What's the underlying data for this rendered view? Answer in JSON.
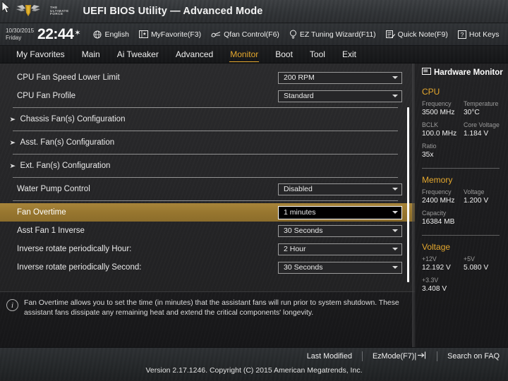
{
  "header": {
    "title": "UEFI BIOS Utility — Advanced Mode",
    "logo": {
      "line1": "THE",
      "line2": "ULTIMATE",
      "line3": "FORCE"
    }
  },
  "toolbar": {
    "date": "10/30/2015",
    "weekday": "Friday",
    "time": "22:44",
    "items": [
      {
        "label": "English",
        "icon": "globe-icon"
      },
      {
        "label": "MyFavorite(F3)",
        "icon": "star-book-icon"
      },
      {
        "label": "Qfan Control(F6)",
        "icon": "fan-icon"
      },
      {
        "label": "EZ Tuning Wizard(F11)",
        "icon": "lightbulb-icon"
      },
      {
        "label": "Quick Note(F9)",
        "icon": "note-icon"
      },
      {
        "label": "Hot Keys",
        "icon": "question-key-icon"
      }
    ]
  },
  "nav": {
    "tabs": [
      {
        "label": "My Favorites",
        "active": false
      },
      {
        "label": "Main",
        "active": false
      },
      {
        "label": "Ai Tweaker",
        "active": false
      },
      {
        "label": "Advanced",
        "active": false
      },
      {
        "label": "Monitor",
        "active": true
      },
      {
        "label": "Boot",
        "active": false
      },
      {
        "label": "Tool",
        "active": false
      },
      {
        "label": "Exit",
        "active": false
      }
    ],
    "active_color": "#e5a82e"
  },
  "settings": {
    "rows": [
      {
        "type": "setting",
        "label": "CPU Fan Speed Lower Limit",
        "value": "200 RPM",
        "selected": false
      },
      {
        "type": "setting",
        "label": "CPU Fan Profile",
        "value": "Standard",
        "selected": false
      },
      {
        "type": "divider"
      },
      {
        "type": "submenu",
        "label": "Chassis Fan(s) Configuration"
      },
      {
        "type": "divider"
      },
      {
        "type": "submenu",
        "label": "Asst. Fan(s) Configuration"
      },
      {
        "type": "divider"
      },
      {
        "type": "submenu",
        "label": "Ext. Fan(s) Configuration"
      },
      {
        "type": "divider"
      },
      {
        "type": "setting",
        "label": "Water Pump Control",
        "value": "Disabled",
        "selected": false
      },
      {
        "type": "divider"
      },
      {
        "type": "setting",
        "label": "Fan Overtime",
        "value": "1 minutes",
        "selected": true
      },
      {
        "type": "setting",
        "label": "Asst Fan 1 Inverse",
        "value": "30 Seconds",
        "selected": false
      },
      {
        "type": "setting",
        "label": "Inverse rotate periodically Hour:",
        "value": "2 Hour",
        "selected": false
      },
      {
        "type": "setting",
        "label": "Inverse rotate periodically Second:",
        "value": "30 Seconds",
        "selected": false
      }
    ],
    "highlight_color": "#97762f"
  },
  "help": {
    "icon": "info-icon",
    "text": "Fan Overtime allows you to set the time (in minutes) that the assistant fans will run prior to system shutdown. These assistant fans dissipate any remaining heat and extend the critical components' longevity."
  },
  "hardware_monitor": {
    "title": "Hardware Monitor",
    "icon": "monitor-icon",
    "groups": [
      {
        "name": "CPU",
        "rows": [
          [
            {
              "key": "Frequency",
              "value": "3500 MHz"
            },
            {
              "key": "Temperature",
              "value": "30°C"
            }
          ],
          [
            {
              "key": "BCLK",
              "value": "100.0 MHz"
            },
            {
              "key": "Core Voltage",
              "value": "1.184 V"
            }
          ],
          [
            {
              "key": "Ratio",
              "value": "35x"
            }
          ]
        ]
      },
      {
        "name": "Memory",
        "rows": [
          [
            {
              "key": "Frequency",
              "value": "2400 MHz"
            },
            {
              "key": "Voltage",
              "value": "1.200 V"
            }
          ],
          [
            {
              "key": "Capacity",
              "value": "16384 MB"
            }
          ]
        ]
      },
      {
        "name": "Voltage",
        "rows": [
          [
            {
              "key": "+12V",
              "value": "12.192 V"
            },
            {
              "key": "+5V",
              "value": "5.080 V"
            }
          ],
          [
            {
              "key": "+3.3V",
              "value": "3.408 V"
            }
          ]
        ]
      }
    ],
    "accent_color": "#e5a82e"
  },
  "footer": {
    "links": [
      {
        "label": "Last Modified",
        "icon": null
      },
      {
        "label": "EzMode(F7)|",
        "icon": "arrow-exit-icon"
      },
      {
        "label": "Search on FAQ",
        "icon": null
      }
    ],
    "copyright": "Version 2.17.1246. Copyright (C) 2015 American Megatrends, Inc."
  }
}
